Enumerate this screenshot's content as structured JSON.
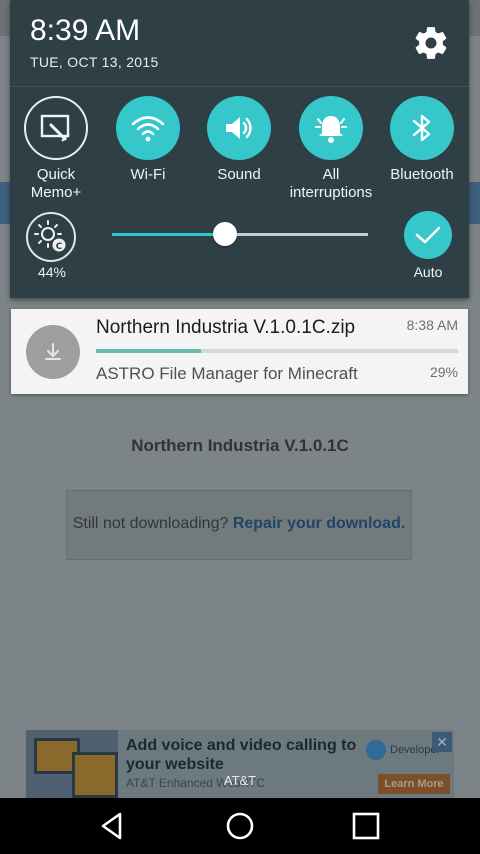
{
  "status": {
    "time": "8:39 AM",
    "date": "TUE, OCT 13, 2015"
  },
  "quick_settings": [
    {
      "label": "Quick\nMemo+",
      "active": false,
      "icon": "quickmemo-icon"
    },
    {
      "label": "Wi-Fi",
      "active": true,
      "icon": "wifi-icon"
    },
    {
      "label": "Sound",
      "active": true,
      "icon": "sound-icon"
    },
    {
      "label": "All\ninterruptions",
      "active": true,
      "icon": "bell-icon"
    },
    {
      "label": "Bluetooth",
      "active": true,
      "icon": "bluetooth-icon"
    }
  ],
  "brightness": {
    "percent_label": "44%",
    "level": 0.44,
    "auto_label": "Auto"
  },
  "notification": {
    "title": "Northern Industria V.1.0.1C.zip",
    "time": "8:38 AM",
    "app": "ASTRO File Manager for Minecraft",
    "percent_label": "29%",
    "progress": 0.29
  },
  "background_page": {
    "file_title": "Northern Industria V.1.0.1C",
    "help_text": "Still not downloading?",
    "help_link": "Repair your download.",
    "ad": {
      "headline": "Add voice and video calling to your website",
      "sub": "AT&T Enhanced WebRTC",
      "brand": "Developer",
      "cta": "Learn More",
      "close": "✕"
    }
  },
  "carrier": "AT&T",
  "colors": {
    "accent": "#35c7c9",
    "shade": "#2f3f46",
    "progress": "#69b9b0"
  }
}
